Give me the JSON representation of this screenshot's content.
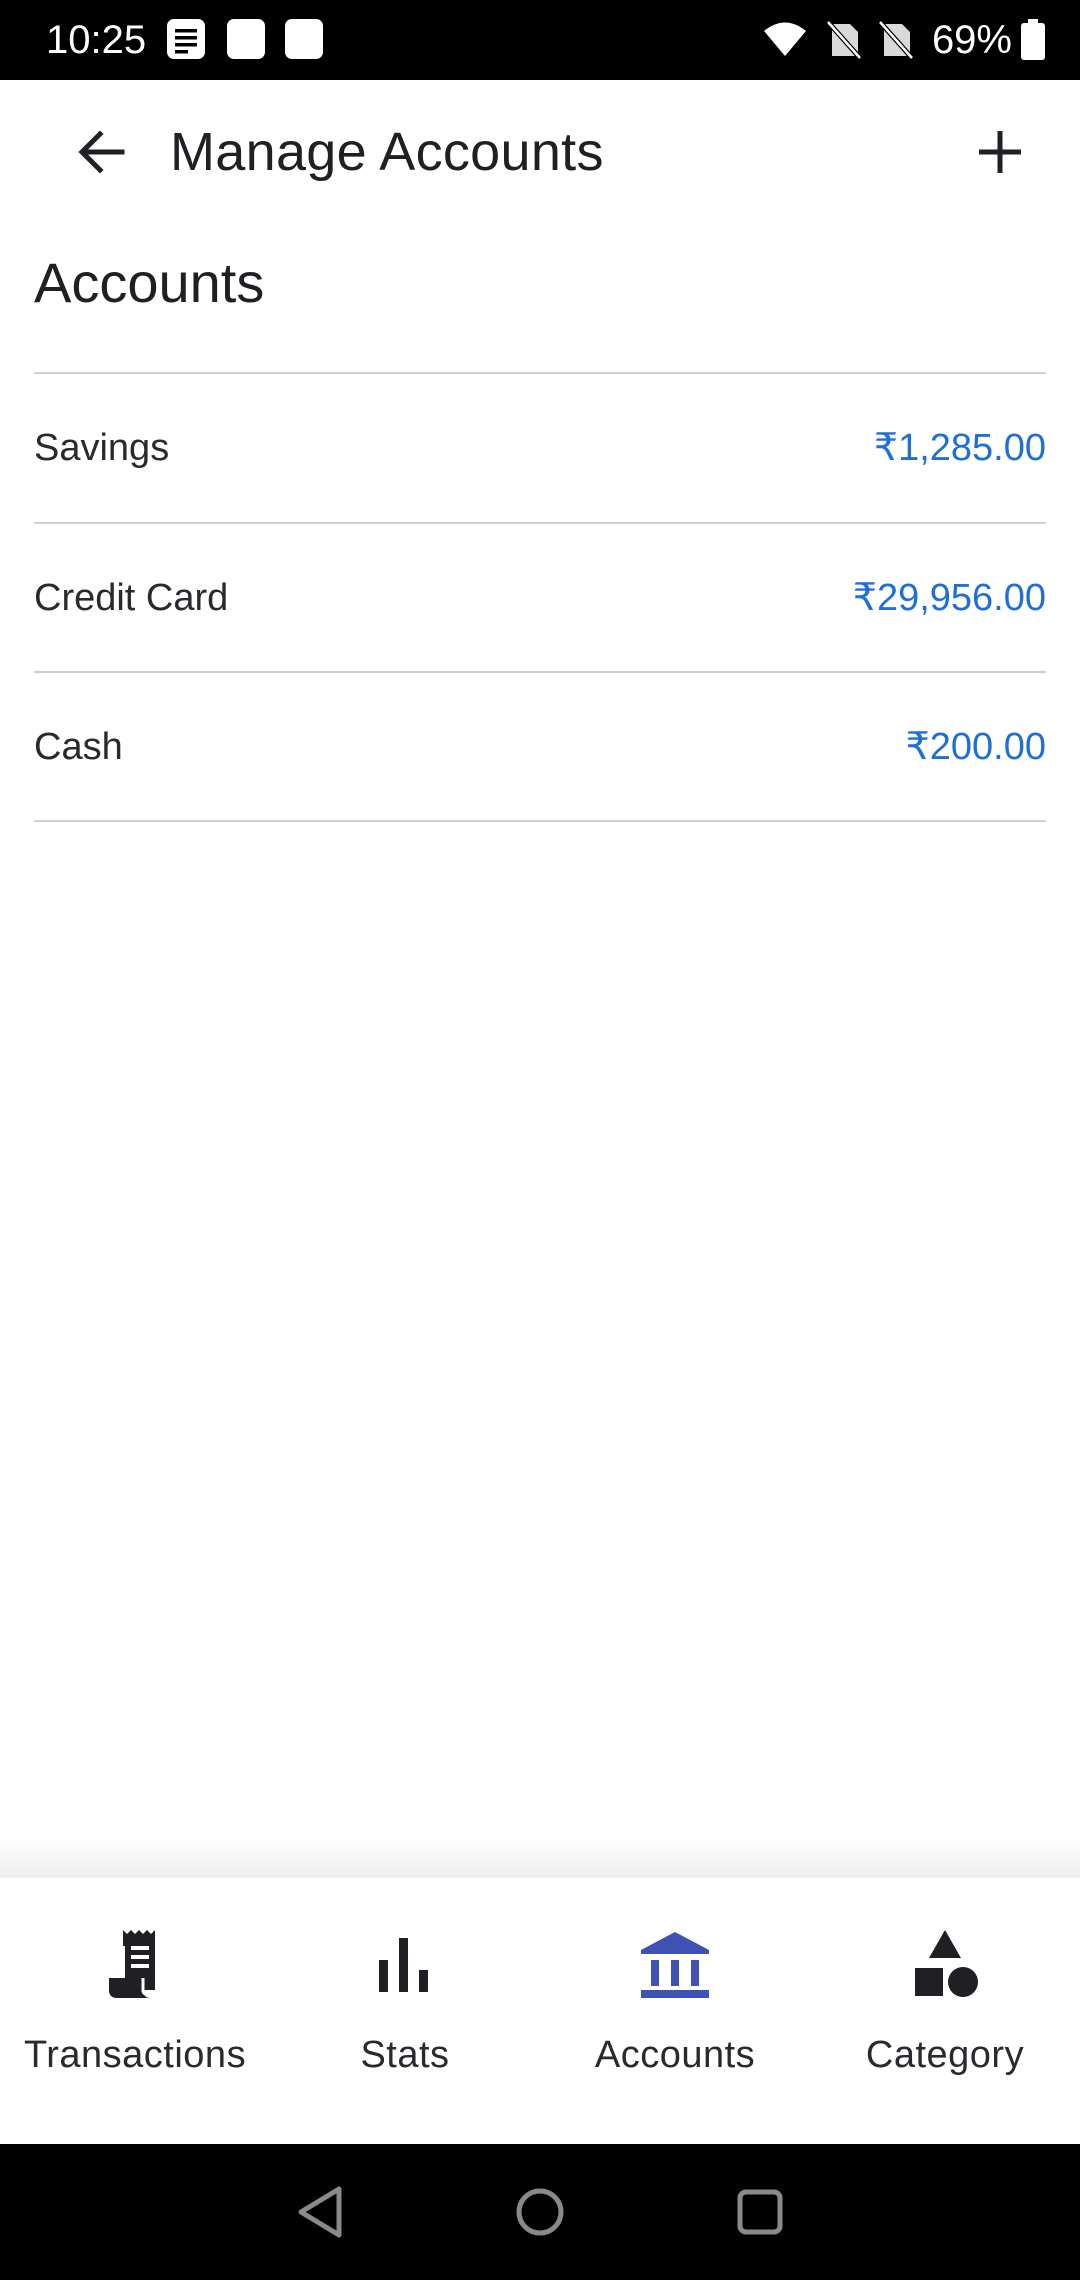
{
  "status_bar": {
    "time": "10:25",
    "battery_percent": "69%",
    "notification_icons": [
      "document-icon",
      "square-icon",
      "square-icon"
    ],
    "right_icons": [
      "wifi-icon",
      "no-sim-icon",
      "no-sim-icon",
      "battery-icon"
    ]
  },
  "app_bar": {
    "title": "Manage Accounts",
    "back_icon": "arrow-left-icon",
    "add_icon": "plus-icon"
  },
  "section": {
    "title": "Accounts"
  },
  "accounts": [
    {
      "name": "Savings",
      "amount": "₹1,285.00"
    },
    {
      "name": "Credit Card",
      "amount": "₹29,956.00"
    },
    {
      "name": "Cash",
      "amount": "₹200.00"
    }
  ],
  "bottom_nav": {
    "active_color": "#3f51b5",
    "items": [
      {
        "label": "Transactions",
        "icon": "receipt-icon",
        "active": false
      },
      {
        "label": "Stats",
        "icon": "bar-chart-icon",
        "active": false
      },
      {
        "label": "Accounts",
        "icon": "bank-icon",
        "active": true
      },
      {
        "label": "Category",
        "icon": "shapes-icon",
        "active": false
      }
    ]
  },
  "colors": {
    "amount": "#1f6fd8",
    "text": "#1f1f24",
    "divider": "#cfcfcf"
  }
}
